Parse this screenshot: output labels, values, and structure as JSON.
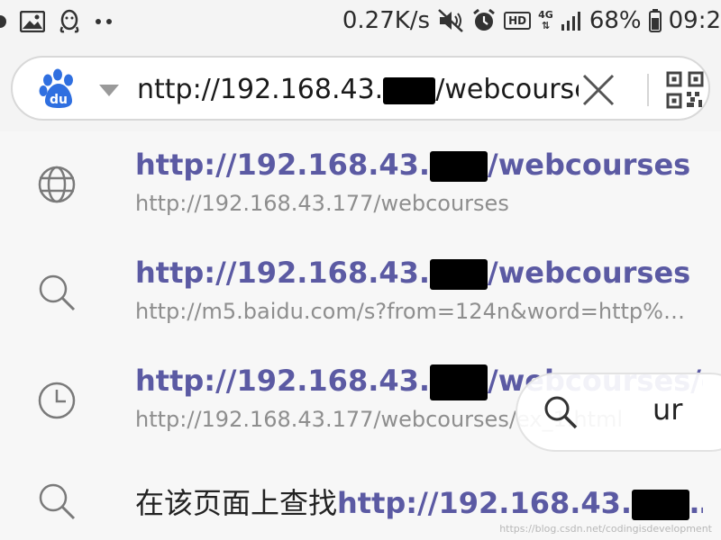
{
  "status_bar": {
    "network_speed": "0.27K/s",
    "hd_label": "HD",
    "network_type": "4G",
    "battery": "68%",
    "time": "09:2"
  },
  "address_bar": {
    "url_prefix": "nttp://192.168.43.",
    "url_suffix": "/webcourses",
    "engine_logo_text": "du"
  },
  "suggestions": [
    {
      "icon": "globe-icon",
      "title_prefix": "http://192.168.43.",
      "title_suffix": "/webcourses",
      "subtitle": "http://192.168.43.177/webcourses"
    },
    {
      "icon": "search-icon",
      "title_prefix": "http://192.168.43.",
      "title_suffix": "/webcourses",
      "subtitle": "http://m5.baidu.com/s?from=124n&word=http%3…"
    },
    {
      "icon": "history-icon",
      "title_prefix": "http://192.168.43.",
      "title_suffix": "/webcourses/e…",
      "subtitle": "http://192.168.43.177/webcourses/ex_1.html"
    },
    {
      "icon": "search-icon",
      "find_prefix": "在该页面上查找",
      "title_prefix": "http://192.168.43.",
      "title_suffix": "…"
    }
  ],
  "find_pill": {
    "text": "ur"
  },
  "watermark": "https://blog.csdn.net/codingisdevelopment"
}
